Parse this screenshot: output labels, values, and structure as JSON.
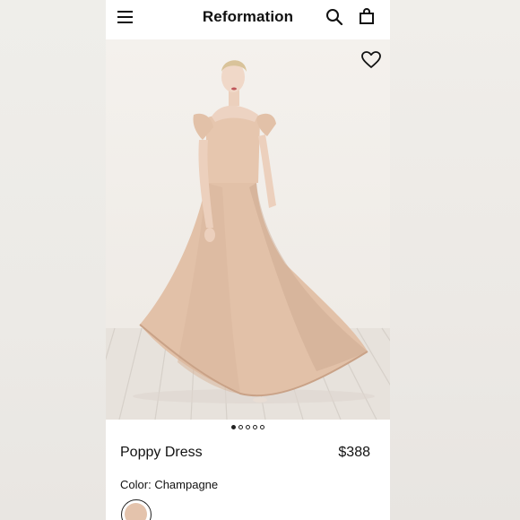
{
  "header": {
    "brand": "Reformation",
    "menu_icon": "hamburger-menu-icon",
    "search_icon": "search-icon",
    "bag_icon": "shopping-bag-icon"
  },
  "gallery": {
    "wishlist_icon": "heart-icon",
    "image_count": 5,
    "active_index": 0
  },
  "product": {
    "name": "Poppy Dress",
    "price": "$388",
    "color_label": "Color:",
    "color_value": "Champagne",
    "swatch_color": "#e4c3ac"
  }
}
